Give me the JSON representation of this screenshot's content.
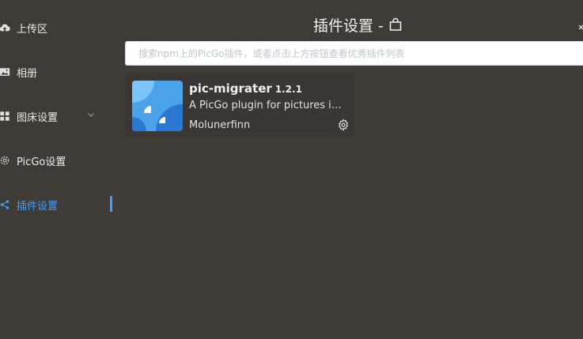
{
  "sidebar": {
    "items": [
      {
        "label": "上传区",
        "icon": "upload-cloud-icon"
      },
      {
        "label": "相册",
        "icon": "image-icon"
      },
      {
        "label": "图床设置",
        "icon": "grid-icon"
      },
      {
        "label": "PicGo设置",
        "icon": "gear-icon"
      },
      {
        "label": "插件设置",
        "icon": "share-icon"
      }
    ],
    "active_index": 4
  },
  "header": {
    "title": "插件设置 -",
    "icon": "shopping-bag-icon"
  },
  "search": {
    "placeholder": "搜索npm上的PicGo插件，或者点击上方按钮查看优秀插件列表",
    "value": ""
  },
  "plugins": [
    {
      "name": "pic-migrater",
      "version": "1.2.1",
      "description": "A PicGo plugin for pictures in markdown",
      "author": "Molunerfinn"
    }
  ],
  "colors": {
    "accent": "#409eff",
    "background": "#3f3c37",
    "card": "#393633"
  }
}
